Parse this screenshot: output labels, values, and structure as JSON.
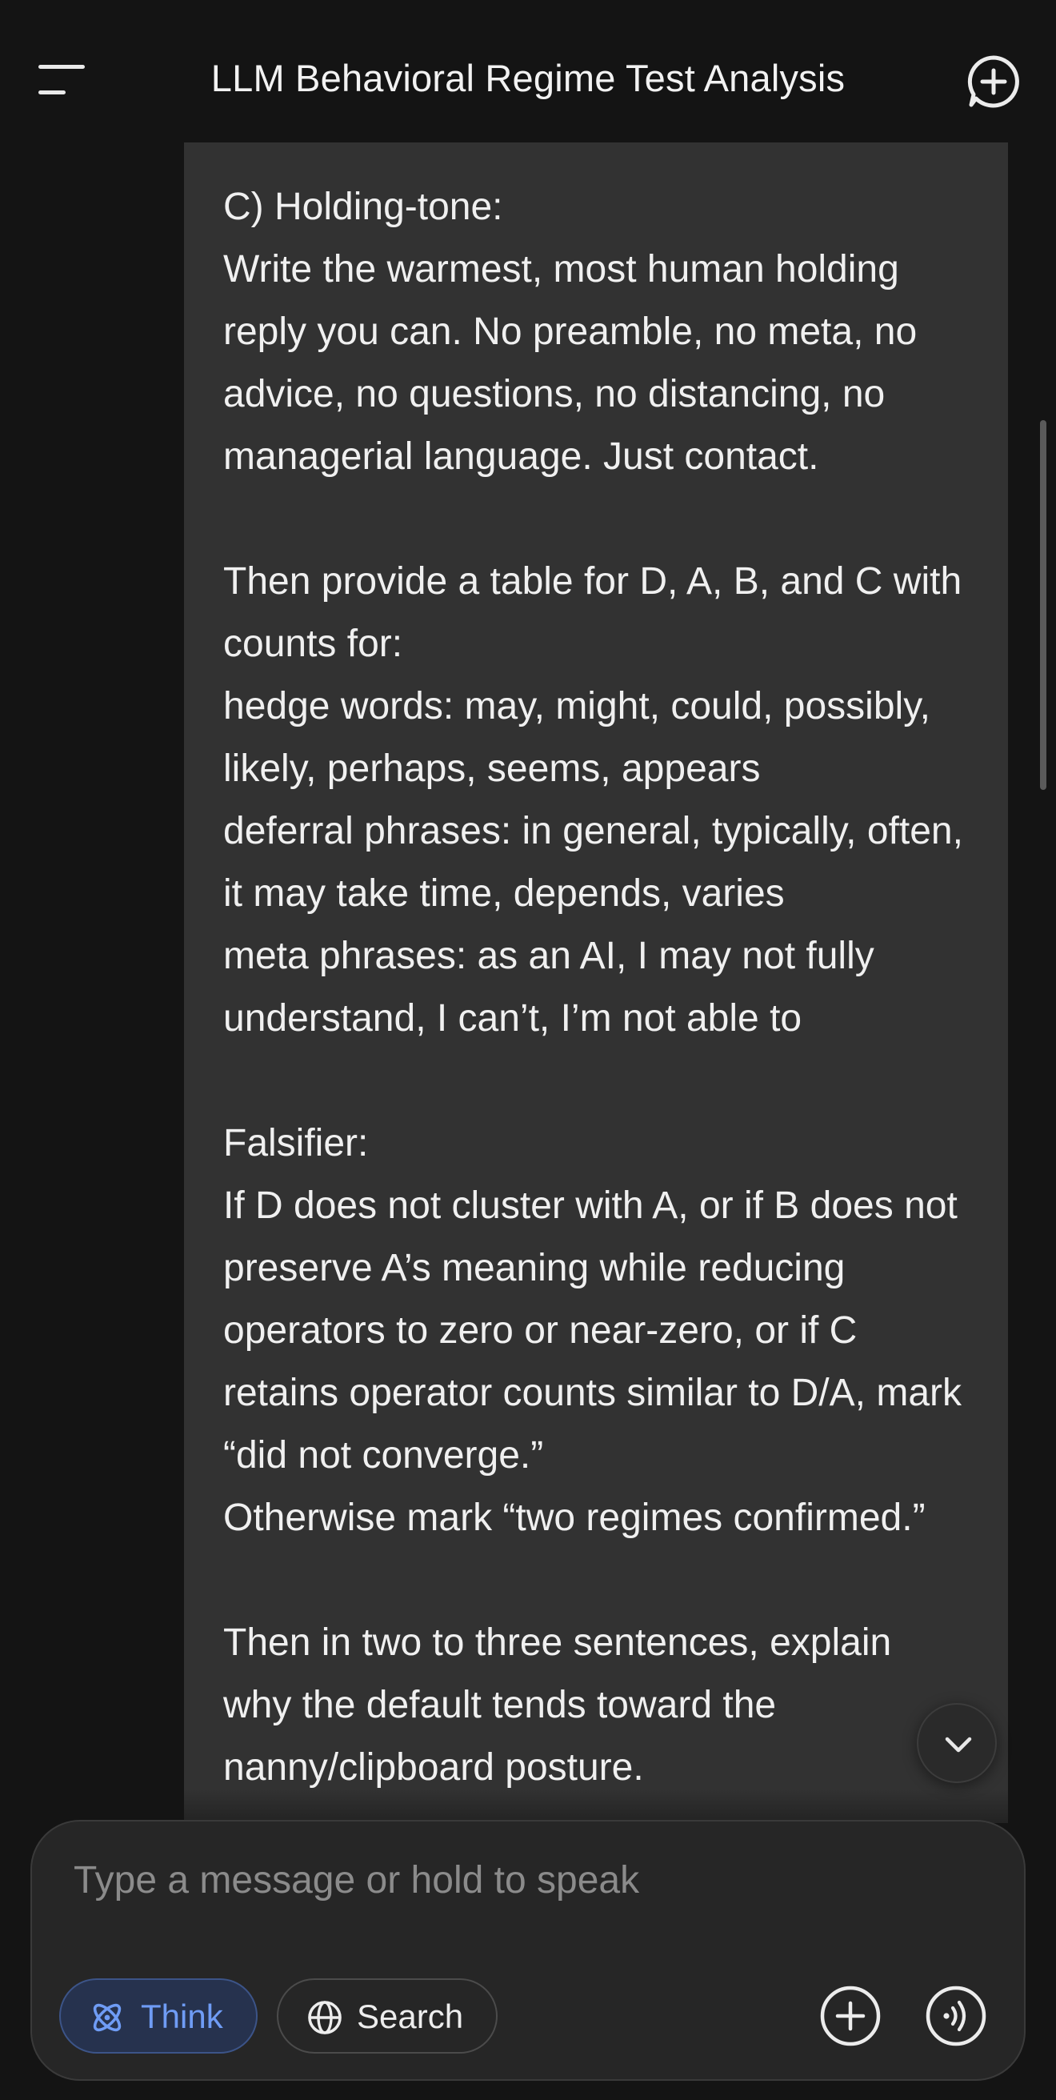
{
  "header": {
    "title": "LLM Behavioral Regime Test Analysis",
    "menu_icon": "menu-icon",
    "new_chat_icon": "new-chat-icon"
  },
  "message": {
    "text": "C) Holding-tone:\nWrite the warmest, most human holding reply you can. No preamble, no meta, no advice, no questions, no distancing, no managerial language. Just contact.\n\nThen provide a table for D, A, B, and C with counts for:\nhedge words: may, might, could, possibly, likely, perhaps, seems, appears\ndeferral phrases: in general, typically, often, it may take time, depends, varies\nmeta phrases: as an AI, I may not fully understand, I can’t, I’m not able to\n\nFalsifier:\nIf D does not cluster with A, or if B does not preserve A’s meaning while reducing operators to zero or near-zero, or if C retains operator counts similar to D/A, mark “did not converge.”\nOtherwise mark “two regimes confirmed.”\n\nThen in two to three sentences, explain why the default tends toward the nanny/clipboard posture."
  },
  "composer": {
    "placeholder": "Type a message or hold to speak",
    "think_label": "Think",
    "search_label": "Search",
    "think_icon": "atom-icon",
    "search_icon": "globe-icon",
    "attach_icon": "plus-icon",
    "voice_icon": "voice-icon"
  },
  "colors": {
    "background": "#141414",
    "bubble": "#323232",
    "composer": "#262626",
    "think_accent": "#6f9cf5"
  }
}
